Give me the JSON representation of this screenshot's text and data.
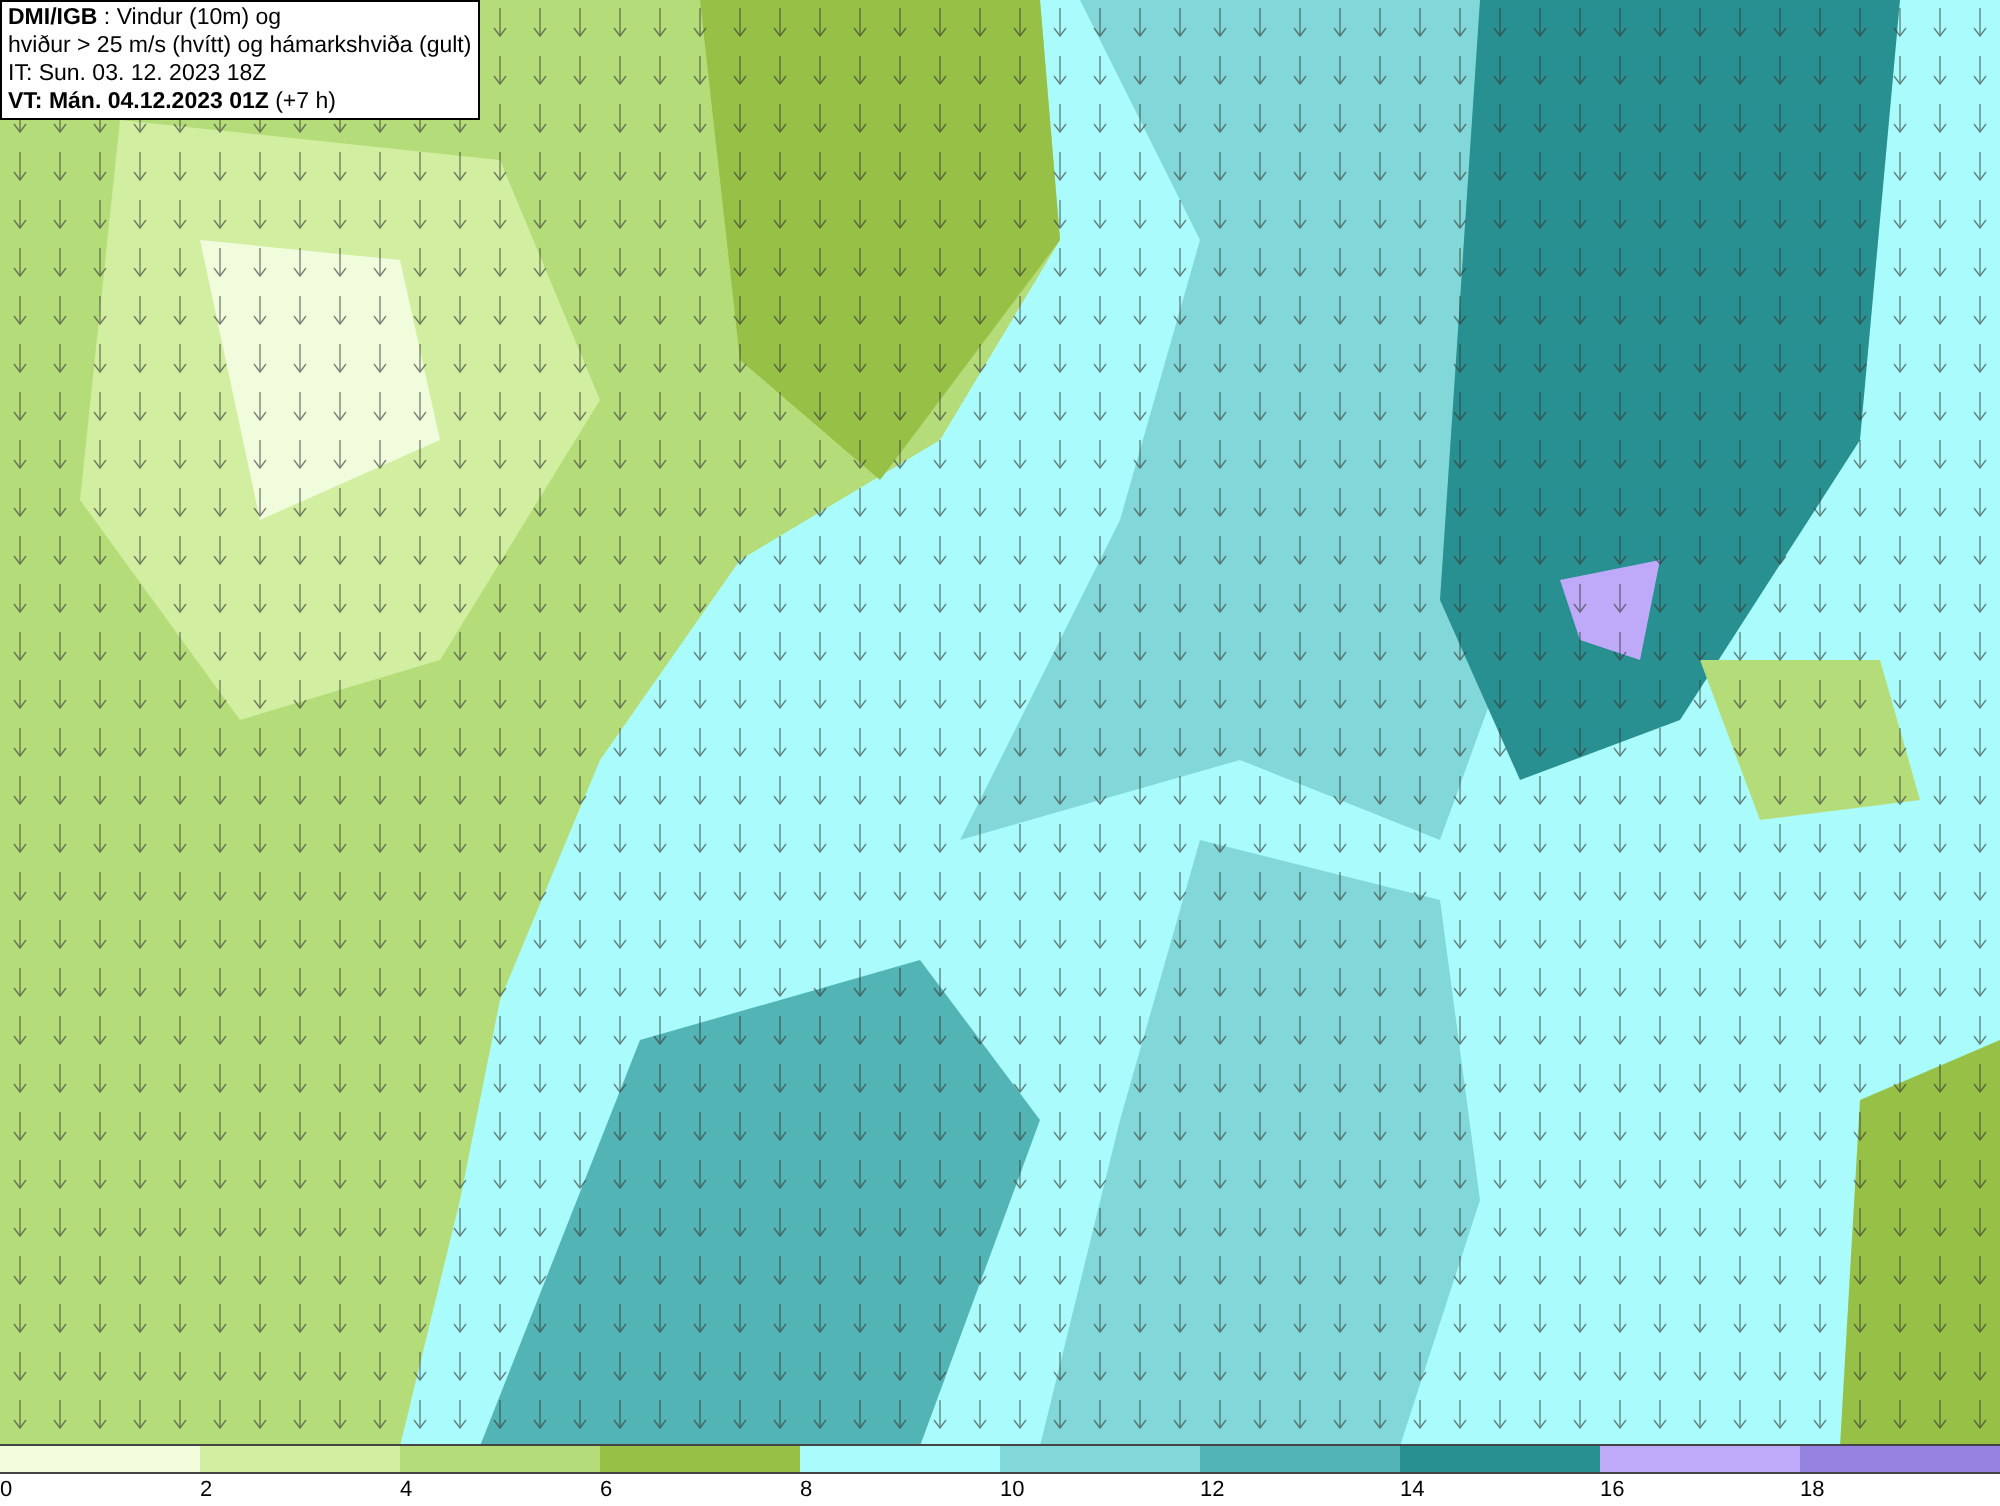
{
  "info_box": {
    "lines": [
      "**DMI/IGB** : Vindur (10m) og",
      "hviður > 25 m/s (hvítt) og hámarkshviða (gult)",
      "IT: Sun. 03. 12. 2023 18Z",
      "**VT: Mán. 04.12.2023 01Z** (+7 h)"
    ]
  },
  "legend": {
    "bins": [
      {
        "label": "0",
        "color": "#f0fcdc"
      },
      {
        "label": "2",
        "color": "#d2eea0"
      },
      {
        "label": "4",
        "color": "#b4dc78"
      },
      {
        "label": "6",
        "color": "#96c046"
      },
      {
        "label": "8",
        "color": "#aafcfc"
      },
      {
        "label": "10",
        "color": "#82d8d8"
      },
      {
        "label": "12",
        "color": "#52b4b4"
      },
      {
        "label": "14",
        "color": "#289090"
      },
      {
        "label": "16",
        "color": "#beaaf8"
      },
      {
        "label": "18",
        "color": "#9682e0"
      }
    ]
  }
}
